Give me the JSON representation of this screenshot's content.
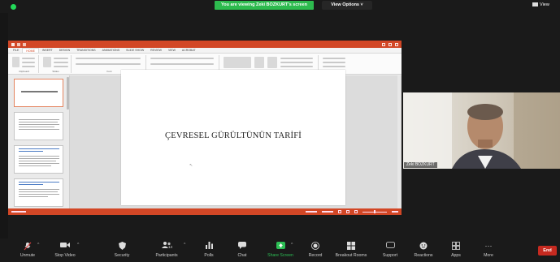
{
  "top_bar": {
    "banner": "You are viewing Zeki BOZKURT's screen",
    "view_options": "View Options ˅",
    "view_label": "View"
  },
  "ppt": {
    "tabs": [
      "FILE",
      "HOME",
      "INSERT",
      "DESIGN",
      "TRANSITIONS",
      "ANIMATIONS",
      "SLIDE SHOW",
      "REVIEW",
      "VIEW",
      "ACROBAT"
    ],
    "slide_title": "ÇEVRESEL GÜRÜLTÜNÜN TARİFİ",
    "ribbon_groups": [
      "Clipboard",
      "Slides",
      "Font",
      "Paragraph",
      "Drawing",
      "Editing"
    ]
  },
  "cam": {
    "name": "Zeki BOZKURT"
  },
  "toolbar": {
    "items": [
      {
        "label": "Unmute",
        "icon": "mic-muted-icon"
      },
      {
        "label": "Stop Video",
        "icon": "video-icon"
      },
      {
        "label": "Security",
        "icon": "shield-icon"
      },
      {
        "label": "Participants",
        "icon": "participants-icon",
        "count": "14"
      },
      {
        "label": "Polls",
        "icon": "polls-icon"
      },
      {
        "label": "Chat",
        "icon": "chat-icon"
      },
      {
        "label": "Share Screen",
        "icon": "share-screen-icon"
      },
      {
        "label": "Record",
        "icon": "record-icon"
      },
      {
        "label": "Breakout Rooms",
        "icon": "breakout-rooms-icon"
      },
      {
        "label": "Support",
        "icon": "support-icon"
      },
      {
        "label": "Reactions",
        "icon": "reactions-icon"
      },
      {
        "label": "Apps",
        "icon": "apps-icon"
      },
      {
        "label": "More",
        "icon": "more-icon"
      }
    ],
    "end_label": "End"
  },
  "colors": {
    "zoom_green": "#2dba4e",
    "ppt_orange": "#d24726",
    "end_red": "#c62a20"
  }
}
